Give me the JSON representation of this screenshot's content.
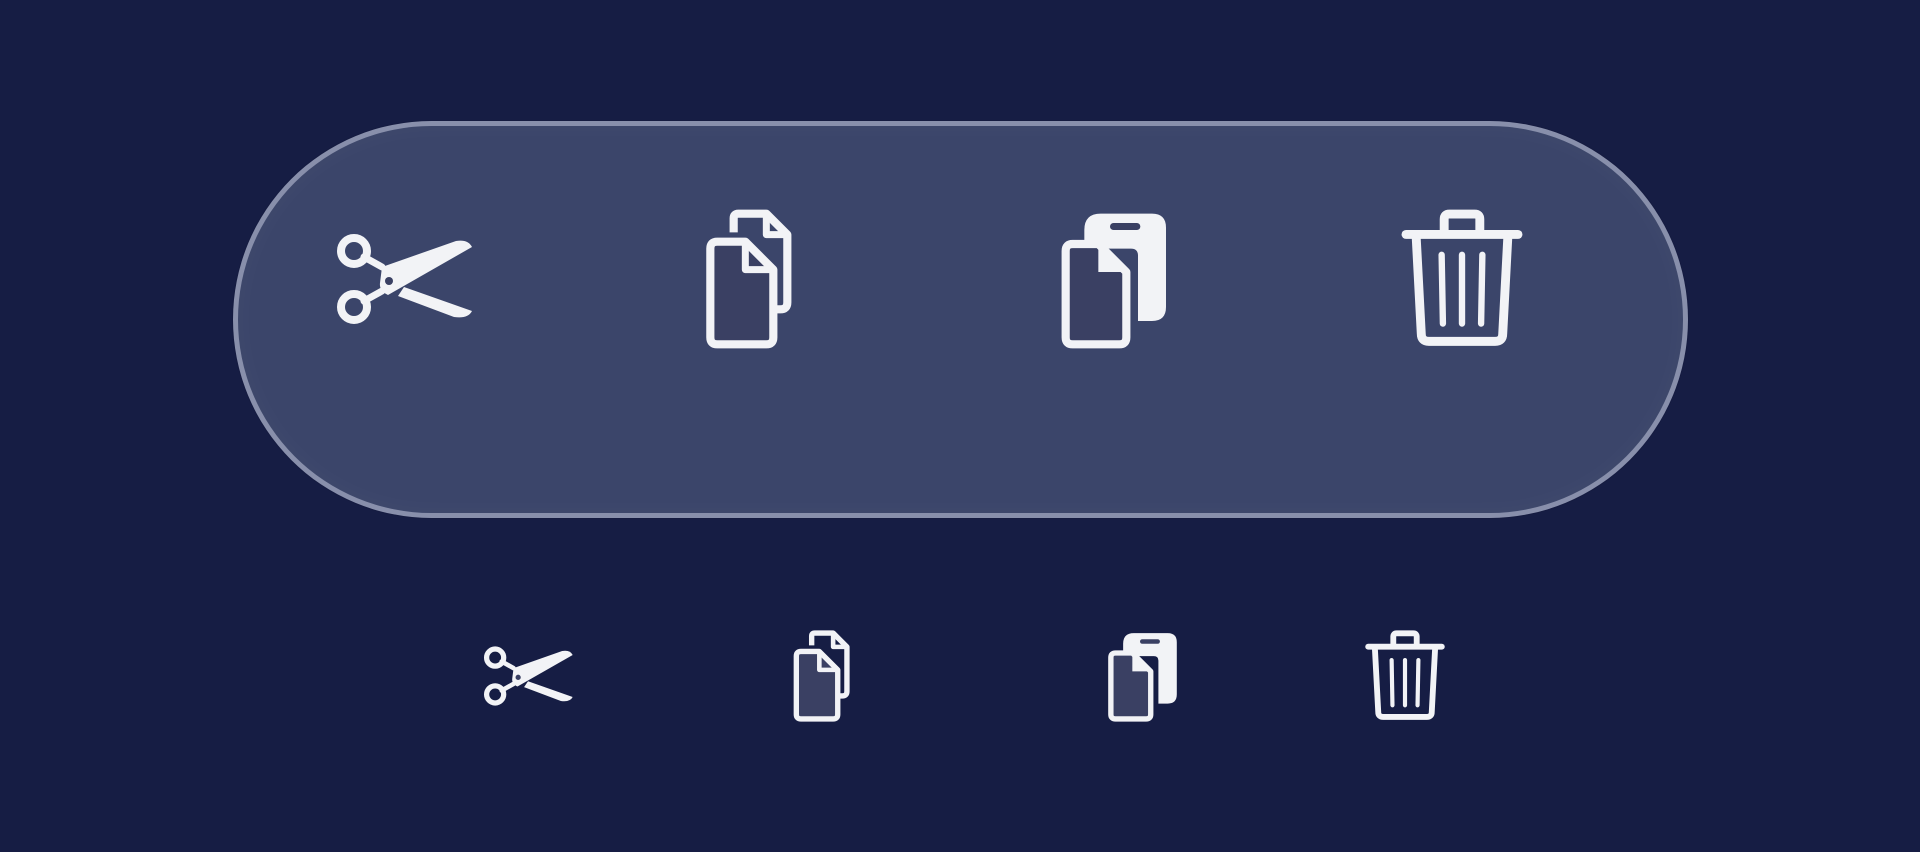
{
  "background_color": "#161d44",
  "toolbar": {
    "fill_color": "#3a4063",
    "border_color": "#9ea4bf",
    "icon_color": "#f2f3f6",
    "buttons": [
      {
        "id": "cut",
        "icon": "scissors-icon"
      },
      {
        "id": "copy",
        "icon": "copy-documents-icon"
      },
      {
        "id": "paste",
        "icon": "paste-clipboard-icon"
      },
      {
        "id": "delete",
        "icon": "trash-icon"
      }
    ]
  },
  "small_icons": [
    {
      "id": "cut",
      "icon": "scissors-icon"
    },
    {
      "id": "copy",
      "icon": "copy-documents-icon"
    },
    {
      "id": "paste",
      "icon": "paste-clipboard-icon"
    },
    {
      "id": "delete",
      "icon": "trash-icon"
    }
  ]
}
